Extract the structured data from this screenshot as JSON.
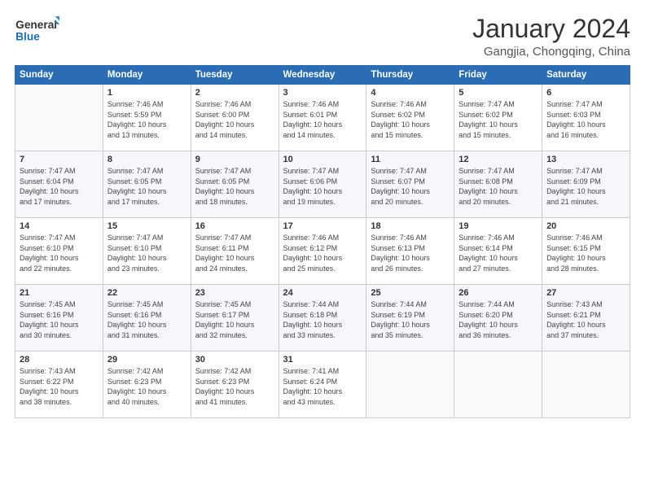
{
  "logo": {
    "line1": "General",
    "line2": "Blue"
  },
  "title": "January 2024",
  "subtitle": "Gangjia, Chongqing, China",
  "days_header": [
    "Sunday",
    "Monday",
    "Tuesday",
    "Wednesday",
    "Thursday",
    "Friday",
    "Saturday"
  ],
  "weeks": [
    [
      {
        "day": "",
        "info": ""
      },
      {
        "day": "1",
        "info": "Sunrise: 7:46 AM\nSunset: 5:59 PM\nDaylight: 10 hours\nand 13 minutes."
      },
      {
        "day": "2",
        "info": "Sunrise: 7:46 AM\nSunset: 6:00 PM\nDaylight: 10 hours\nand 14 minutes."
      },
      {
        "day": "3",
        "info": "Sunrise: 7:46 AM\nSunset: 6:01 PM\nDaylight: 10 hours\nand 14 minutes."
      },
      {
        "day": "4",
        "info": "Sunrise: 7:46 AM\nSunset: 6:02 PM\nDaylight: 10 hours\nand 15 minutes."
      },
      {
        "day": "5",
        "info": "Sunrise: 7:47 AM\nSunset: 6:02 PM\nDaylight: 10 hours\nand 15 minutes."
      },
      {
        "day": "6",
        "info": "Sunrise: 7:47 AM\nSunset: 6:03 PM\nDaylight: 10 hours\nand 16 minutes."
      }
    ],
    [
      {
        "day": "7",
        "info": "Sunrise: 7:47 AM\nSunset: 6:04 PM\nDaylight: 10 hours\nand 17 minutes."
      },
      {
        "day": "8",
        "info": "Sunrise: 7:47 AM\nSunset: 6:05 PM\nDaylight: 10 hours\nand 17 minutes."
      },
      {
        "day": "9",
        "info": "Sunrise: 7:47 AM\nSunset: 6:05 PM\nDaylight: 10 hours\nand 18 minutes."
      },
      {
        "day": "10",
        "info": "Sunrise: 7:47 AM\nSunset: 6:06 PM\nDaylight: 10 hours\nand 19 minutes."
      },
      {
        "day": "11",
        "info": "Sunrise: 7:47 AM\nSunset: 6:07 PM\nDaylight: 10 hours\nand 20 minutes."
      },
      {
        "day": "12",
        "info": "Sunrise: 7:47 AM\nSunset: 6:08 PM\nDaylight: 10 hours\nand 20 minutes."
      },
      {
        "day": "13",
        "info": "Sunrise: 7:47 AM\nSunset: 6:09 PM\nDaylight: 10 hours\nand 21 minutes."
      }
    ],
    [
      {
        "day": "14",
        "info": "Sunrise: 7:47 AM\nSunset: 6:10 PM\nDaylight: 10 hours\nand 22 minutes."
      },
      {
        "day": "15",
        "info": "Sunrise: 7:47 AM\nSunset: 6:10 PM\nDaylight: 10 hours\nand 23 minutes."
      },
      {
        "day": "16",
        "info": "Sunrise: 7:47 AM\nSunset: 6:11 PM\nDaylight: 10 hours\nand 24 minutes."
      },
      {
        "day": "17",
        "info": "Sunrise: 7:46 AM\nSunset: 6:12 PM\nDaylight: 10 hours\nand 25 minutes."
      },
      {
        "day": "18",
        "info": "Sunrise: 7:46 AM\nSunset: 6:13 PM\nDaylight: 10 hours\nand 26 minutes."
      },
      {
        "day": "19",
        "info": "Sunrise: 7:46 AM\nSunset: 6:14 PM\nDaylight: 10 hours\nand 27 minutes."
      },
      {
        "day": "20",
        "info": "Sunrise: 7:46 AM\nSunset: 6:15 PM\nDaylight: 10 hours\nand 28 minutes."
      }
    ],
    [
      {
        "day": "21",
        "info": "Sunrise: 7:45 AM\nSunset: 6:16 PM\nDaylight: 10 hours\nand 30 minutes."
      },
      {
        "day": "22",
        "info": "Sunrise: 7:45 AM\nSunset: 6:16 PM\nDaylight: 10 hours\nand 31 minutes."
      },
      {
        "day": "23",
        "info": "Sunrise: 7:45 AM\nSunset: 6:17 PM\nDaylight: 10 hours\nand 32 minutes."
      },
      {
        "day": "24",
        "info": "Sunrise: 7:44 AM\nSunset: 6:18 PM\nDaylight: 10 hours\nand 33 minutes."
      },
      {
        "day": "25",
        "info": "Sunrise: 7:44 AM\nSunset: 6:19 PM\nDaylight: 10 hours\nand 35 minutes."
      },
      {
        "day": "26",
        "info": "Sunrise: 7:44 AM\nSunset: 6:20 PM\nDaylight: 10 hours\nand 36 minutes."
      },
      {
        "day": "27",
        "info": "Sunrise: 7:43 AM\nSunset: 6:21 PM\nDaylight: 10 hours\nand 37 minutes."
      }
    ],
    [
      {
        "day": "28",
        "info": "Sunrise: 7:43 AM\nSunset: 6:22 PM\nDaylight: 10 hours\nand 38 minutes."
      },
      {
        "day": "29",
        "info": "Sunrise: 7:42 AM\nSunset: 6:23 PM\nDaylight: 10 hours\nand 40 minutes."
      },
      {
        "day": "30",
        "info": "Sunrise: 7:42 AM\nSunset: 6:23 PM\nDaylight: 10 hours\nand 41 minutes."
      },
      {
        "day": "31",
        "info": "Sunrise: 7:41 AM\nSunset: 6:24 PM\nDaylight: 10 hours\nand 43 minutes."
      },
      {
        "day": "",
        "info": ""
      },
      {
        "day": "",
        "info": ""
      },
      {
        "day": "",
        "info": ""
      }
    ]
  ]
}
